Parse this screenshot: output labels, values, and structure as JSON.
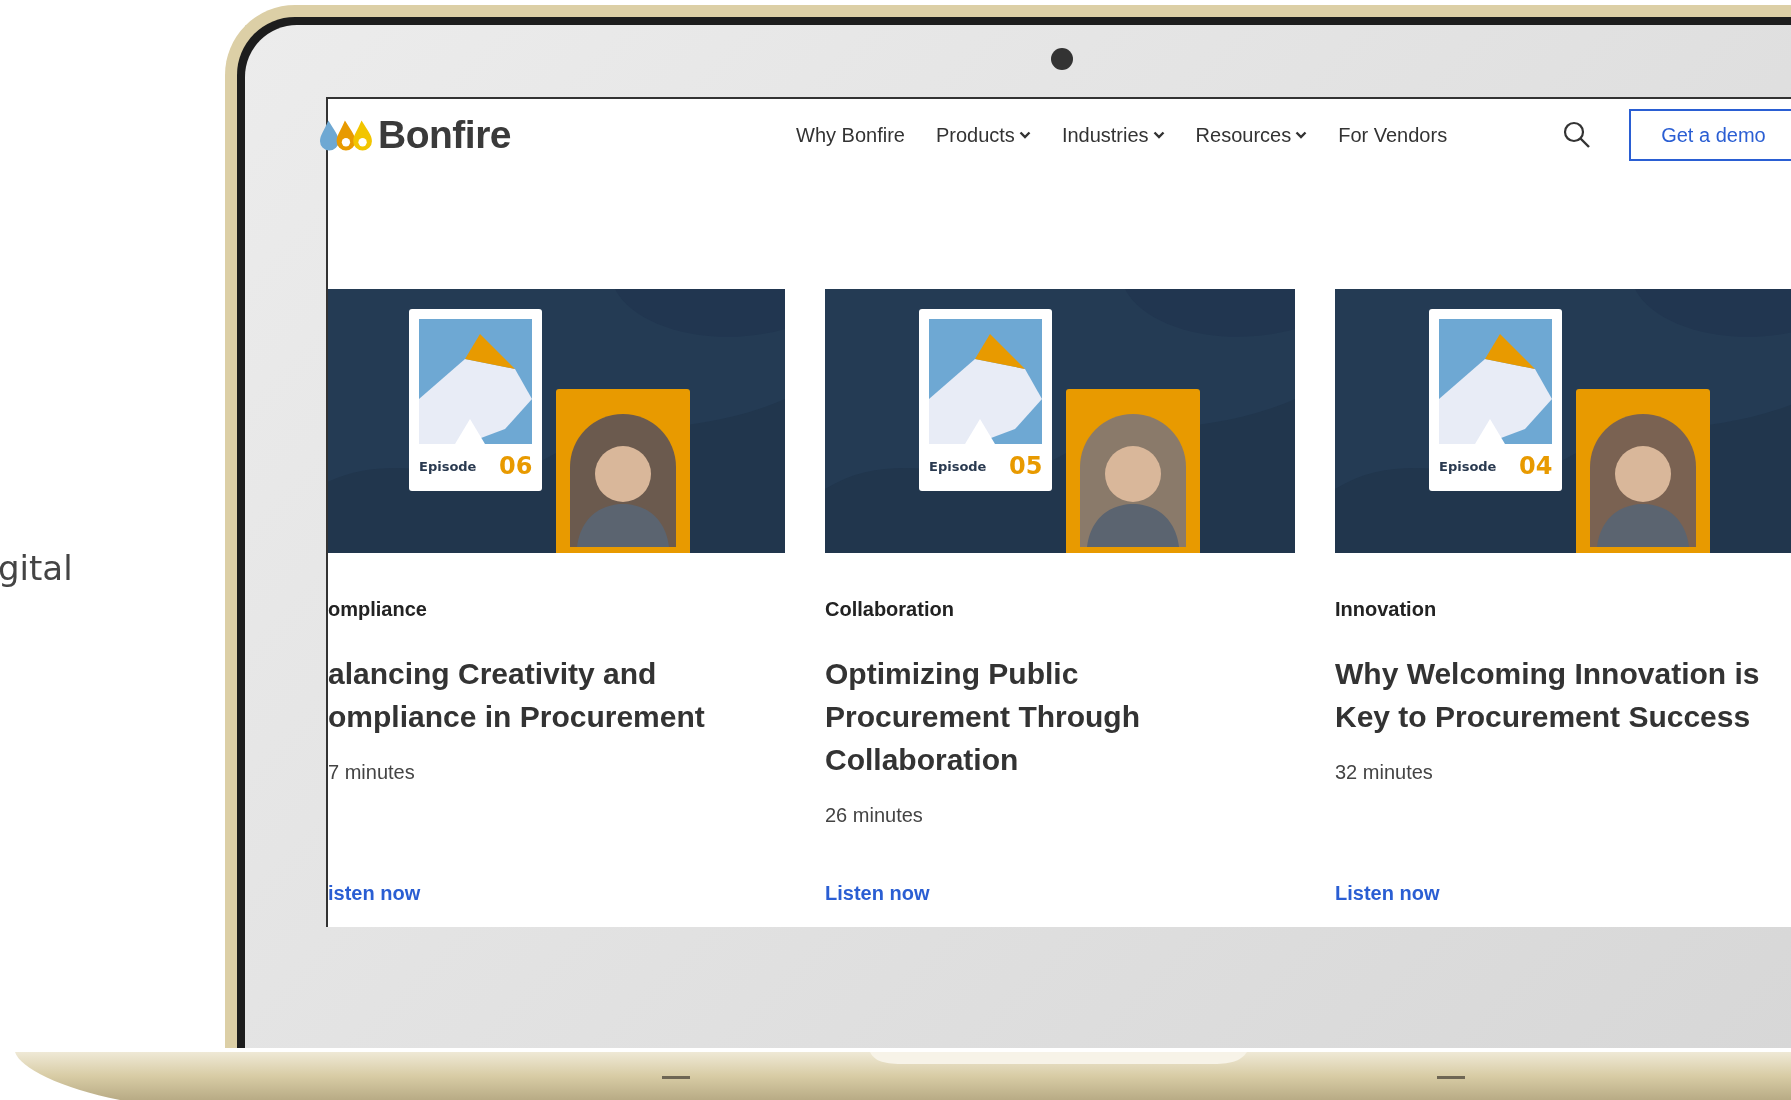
{
  "side_text": "gital",
  "page": {
    "logo": {
      "name": "Bonfire"
    },
    "nav": [
      {
        "label": "Why Bonfire",
        "dropdown": false
      },
      {
        "label": "Products",
        "dropdown": true
      },
      {
        "label": "Industries",
        "dropdown": true
      },
      {
        "label": "Resources",
        "dropdown": true
      },
      {
        "label": "For Vendors",
        "dropdown": false
      }
    ],
    "demo_button": "Get a demo",
    "episodes": [
      {
        "category": "ompliance",
        "title_lines": [
          "alancing Creativity and",
          "ompliance in Procurement"
        ],
        "duration": "7 minutes",
        "link": "isten now",
        "episode_label": "Episode",
        "episode_number": "06"
      },
      {
        "category": "Collaboration",
        "title_lines": [
          "Optimizing Public",
          "Procurement Through",
          "Collaboration"
        ],
        "duration": "26 minutes",
        "link": "Listen now",
        "episode_label": "Episode",
        "episode_number": "05"
      },
      {
        "category": "Innovation",
        "title_lines": [
          "Why Welcoming Innovation is",
          "Key to Procurement Success"
        ],
        "duration": "32 minutes",
        "link": "Listen now",
        "episode_label": "Episode",
        "episode_number": "04"
      }
    ]
  }
}
